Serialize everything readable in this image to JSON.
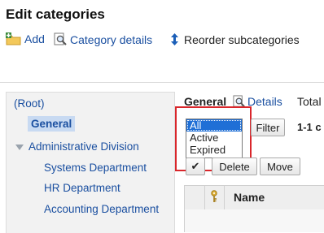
{
  "page": {
    "title": "Edit categories"
  },
  "toolbar": {
    "add_label": "Add",
    "details_label": "Category details",
    "reorder_label": "Reorder subcategories"
  },
  "tree": {
    "root_label": "(Root)",
    "general_label": "General",
    "admin_label": "Administrative Division",
    "children": [
      "Systems Department",
      "HR Department",
      "Accounting Department"
    ]
  },
  "main": {
    "category_name": "General",
    "details_link": "Details",
    "total_label": "Total",
    "range_label": "1-1 c",
    "filter": {
      "options": [
        "All",
        "Active",
        "Expired"
      ],
      "selected": "All"
    },
    "filter_button": "Filter",
    "delete_button": "Delete",
    "move_button": "Move",
    "column_name": "Name"
  }
}
